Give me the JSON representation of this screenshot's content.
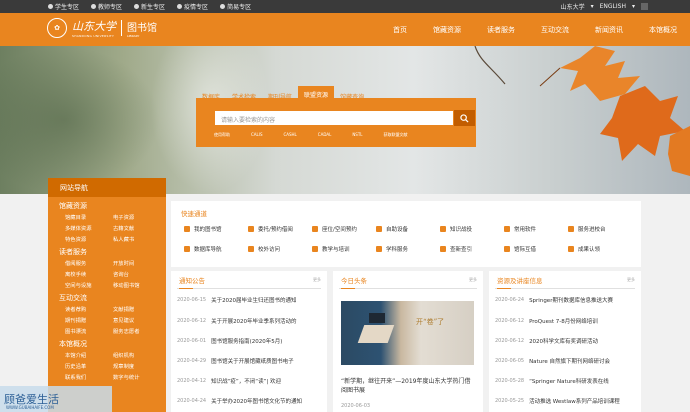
{
  "topbar": {
    "links": [
      "学生专区",
      "教师专区",
      "新生专区",
      "疫情专区",
      "简易专区"
    ],
    "right": [
      "山东大学",
      "ENGLISH"
    ]
  },
  "logo": {
    "cn": "山东大学",
    "en": "SHANDONG UNIVERSITY",
    "library": "图书馆",
    "library_en": "LIBRARY"
  },
  "nav": [
    "首页",
    "馆藏资源",
    "读者服务",
    "互动交流",
    "新闻资讯",
    "本馆概况"
  ],
  "search": {
    "tabs": [
      "数据库",
      "学术检索",
      "期刊导航",
      "联盟资源",
      "馆藏查询"
    ],
    "active_tab": "联盟资源",
    "placeholder": "请输入要检索的内容",
    "quick_links": [
      "使用帮助",
      "CALIS",
      "CASHL",
      "CADAL",
      "NSTL",
      "获取联盟文献"
    ]
  },
  "sidebar": {
    "title": "网站导航",
    "groups": [
      {
        "title": "馆藏资源",
        "items": [
          "馆藏目录",
          "电子资源",
          "多媒体资源",
          "古籍文献",
          "特色资源",
          "私人藏书"
        ]
      },
      {
        "title": "读者服务",
        "items": [
          "借阅服务",
          "开放时间",
          "离校手续",
          "咨询台",
          "空间与设施",
          "移动图书馆"
        ]
      },
      {
        "title": "互动交流",
        "items": [
          "读者荐购",
          "文献捐赠",
          "期刊捐赠",
          "意见建议",
          "图书漂流",
          "服务志愿者"
        ]
      },
      {
        "title": "本馆概况",
        "items": [
          "本馆介绍",
          "组织机构",
          "历史沿革",
          "规章制度",
          "联系我们",
          "数字与统计"
        ]
      }
    ]
  },
  "quick": {
    "title": "快速通道",
    "items": [
      "我的图书馆",
      "委托/预约借阅",
      "座位/空间预约",
      "自助设备",
      "知识战役",
      "常用软件",
      "服务进校台",
      "数据库导航",
      "校外访问",
      "教学与培训",
      "学科服务",
      "查新查引",
      "馆际互借",
      "成果认领"
    ]
  },
  "notice": {
    "title": "通知公告",
    "more": "更多",
    "items": [
      {
        "date": "2020-06-15",
        "text": "关于2020届毕业生归还图书的通知"
      },
      {
        "date": "2020-06-12",
        "text": "关于开展2020年毕业季系列活动的"
      },
      {
        "date": "2020-06-01",
        "text": "图书馆服务指南(2020年5月)"
      },
      {
        "date": "2020-04-29",
        "text": "图书馆关于开展馆藏纸质图书电子"
      },
      {
        "date": "2020-04-12",
        "text": "知识战“疫”，不闭“读”| 欢迎"
      },
      {
        "date": "2020-04-24",
        "text": "关于举办2020年图书馆文化节的通知"
      }
    ]
  },
  "news": {
    "title": "今日头条",
    "more": "更多",
    "image_text": "开“卷”了",
    "caption": "“新学期，继往开来”—2019年度山东大学热门借阅图书展",
    "date": "2020-06-03"
  },
  "resources": {
    "title": "资源及讲座信息",
    "more": "更多",
    "items": [
      {
        "date": "2020-06-24",
        "text": "Springer期刊数据库信息推送大赛"
      },
      {
        "date": "2020-06-12",
        "text": "ProQuest 7-8月份网络培训"
      },
      {
        "date": "2020-06-12",
        "text": "2020科学文库有奖调研活动"
      },
      {
        "date": "2020-06-05",
        "text": "Nature 自然旗下期刊网络研讨会"
      },
      {
        "date": "2020-05-28",
        "text": "“Springer Nature科研发表在线"
      },
      {
        "date": "2020-05-25",
        "text": "活动推选 Westlaw系列产品培训课程"
      }
    ]
  },
  "watermark": {
    "title": "顾爸爱生活",
    "url": "WWW.GUBAIHAIFE.COM"
  },
  "colors": {
    "accent": "#e9851f",
    "dark_accent": "#d06a00",
    "topbar": "#3a3a3a"
  }
}
